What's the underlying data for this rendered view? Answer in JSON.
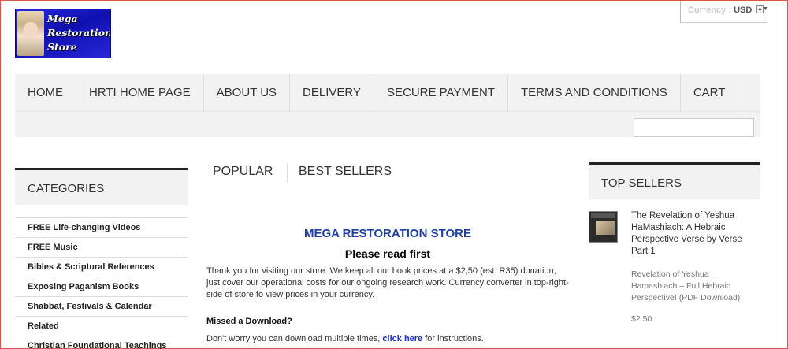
{
  "logo": {
    "lines": [
      "Mega",
      "Restoration",
      "Store"
    ]
  },
  "currency": {
    "label": "Currency :",
    "value": "USD"
  },
  "nav": {
    "items": [
      "HOME",
      "HRTI HOME PAGE",
      "ABOUT US",
      "DELIVERY",
      "SECURE PAYMENT",
      "TERMS AND CONDITIONS",
      "CART"
    ]
  },
  "search": {
    "placeholder": ""
  },
  "categories": {
    "title": "CATEGORIES",
    "items": [
      "FREE Life-changing Videos",
      "FREE Music",
      "Bibles & Scriptural References",
      "Exposing Paganism Books",
      "Shabbat, Festivals & Calendar",
      "Related",
      "Christian Foundational Teachings"
    ]
  },
  "tabs": {
    "popular": "POPULAR",
    "best_sellers": "BEST SELLERS"
  },
  "main": {
    "store_title": "MEGA RESTORATION STORE",
    "read_first": "Please read first",
    "intro": "Thank you for visiting our store. We keep all our book prices at a $2,50 (est. R35) donation, just cover our operational costs for our ongoing research work. Currency converter in top-right-side of store to view prices in your currency.",
    "missed_heading": "Missed a Download?",
    "missed_text_before": "Don't worry you can download multiple times, ",
    "missed_link": "click here",
    "missed_text_after": " for instructions."
  },
  "top_sellers": {
    "title": "TOP SELLERS",
    "items": [
      {
        "title": "The Revelation of Yeshua HaMashiach: A Hebraic Perspective Verse by Verse Part 1",
        "description": "Revelation of Yeshua Hamashiach – Full Hebraic Perspective! (PDF Download)",
        "price": "$2.50"
      }
    ]
  }
}
